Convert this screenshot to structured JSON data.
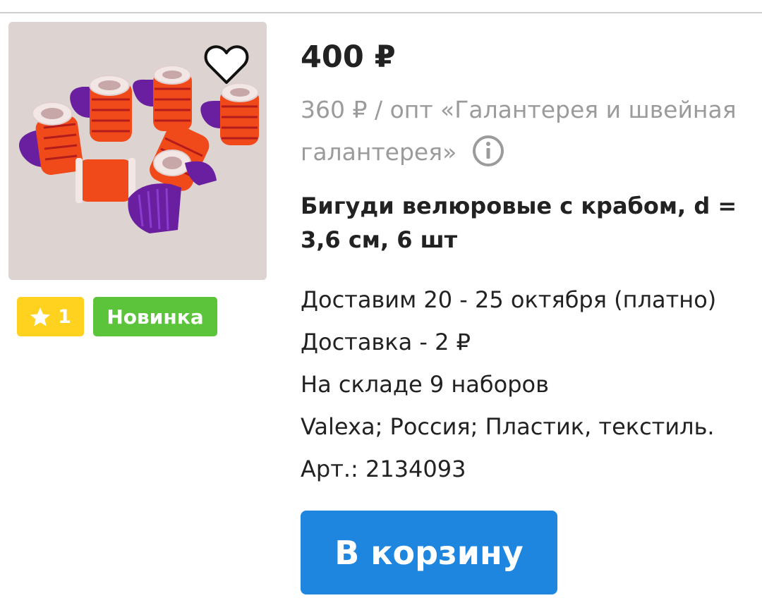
{
  "product": {
    "image_alt": "Бигуди велюровые с крабом",
    "price": "400 ₽",
    "wholesale_text": "360 ₽ / опт «Галантерея и швейная галантерея»",
    "title": "Бигуди велюровые с крабом, d = 3,6 см, 6 шт"
  },
  "badges": {
    "rating": "1",
    "new_label": "Новинка"
  },
  "details": {
    "delivery_date": "Доставим 20 - 25 октября (платно)",
    "delivery_cost": "Доставка - 2 ₽",
    "stock": "На складе 9 наборов",
    "brand_info": "Valexa; Россия; Пластик, текстиль.",
    "article": "Арт.: 2134093"
  },
  "actions": {
    "cart_button": "В корзину"
  },
  "icons": {
    "favorite": "heart-outline-icon",
    "info": "info-circle-icon",
    "star": "star-icon"
  },
  "colors": {
    "accent_blue": "#1f86e0",
    "badge_yellow": "#ffd21f",
    "badge_green": "#5cc43a",
    "muted_text": "#9b9b9b"
  }
}
